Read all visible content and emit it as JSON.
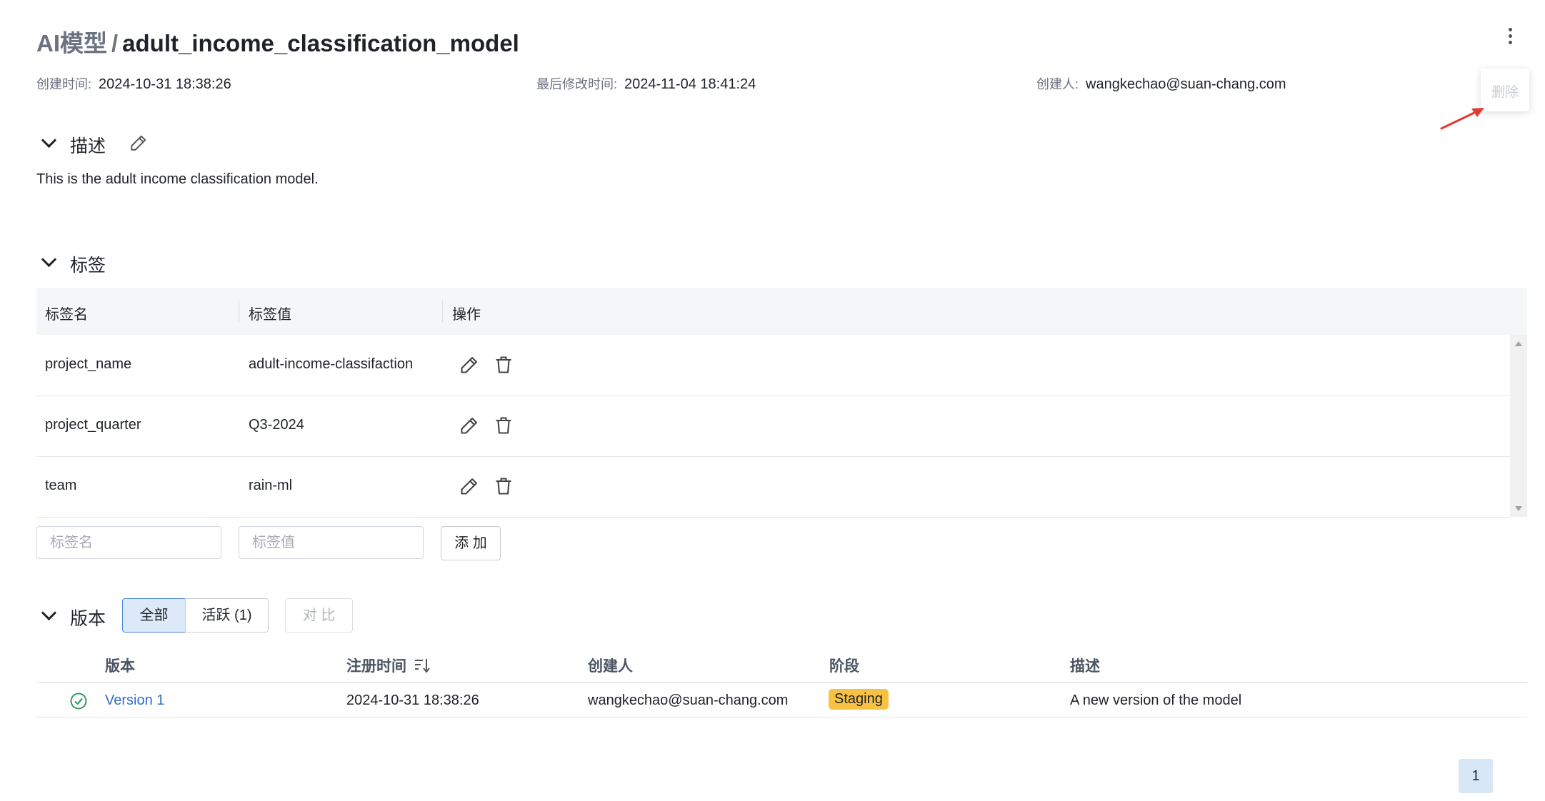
{
  "header": {
    "breadcrumb": "AI模型",
    "separator": "/",
    "model_name": "adult_income_classification_model",
    "more_menu": {
      "icon": "more-vertical-icon",
      "items": [
        "删除"
      ]
    }
  },
  "meta": {
    "created_label": "创建时间:",
    "created_value": "2024-10-31 18:38:26",
    "modified_label": "最后修改时间:",
    "modified_value": "2024-11-04 18:41:24",
    "creator_label": "创建人:",
    "creator_value": "wangkechao@suan-chang.com"
  },
  "description_section": {
    "title": "描述",
    "text": "This is the adult income classification model."
  },
  "tags_section": {
    "title": "标签",
    "columns": [
      "标签名",
      "标签值",
      "操作"
    ],
    "rows": [
      {
        "name": "project_name",
        "value": "adult-income-classifaction"
      },
      {
        "name": "project_quarter",
        "value": "Q3-2024"
      },
      {
        "name": "team",
        "value": "rain-ml"
      }
    ],
    "name_placeholder": "标签名",
    "value_placeholder": "标签值",
    "add_label": "添 加"
  },
  "versions_section": {
    "title": "版本",
    "filter_all": "全部",
    "filter_active": "活跃 (1)",
    "compare_label": "对 比",
    "columns": [
      "版本",
      "注册时间",
      "创建人",
      "阶段",
      "描述"
    ],
    "rows": [
      {
        "version": "Version 1",
        "registered": "2024-10-31 18:38:26",
        "creator": "wangkechao@suan-chang.com",
        "stage": "Staging",
        "description": "A new version of the model"
      }
    ]
  },
  "pagination": {
    "current": "1"
  },
  "colors": {
    "accent": "#4a88d6",
    "link": "#2f6fc8",
    "stage_badge": "#f7c244",
    "status_ok": "#2e9e63",
    "annotation_arrow": "#e53935"
  }
}
